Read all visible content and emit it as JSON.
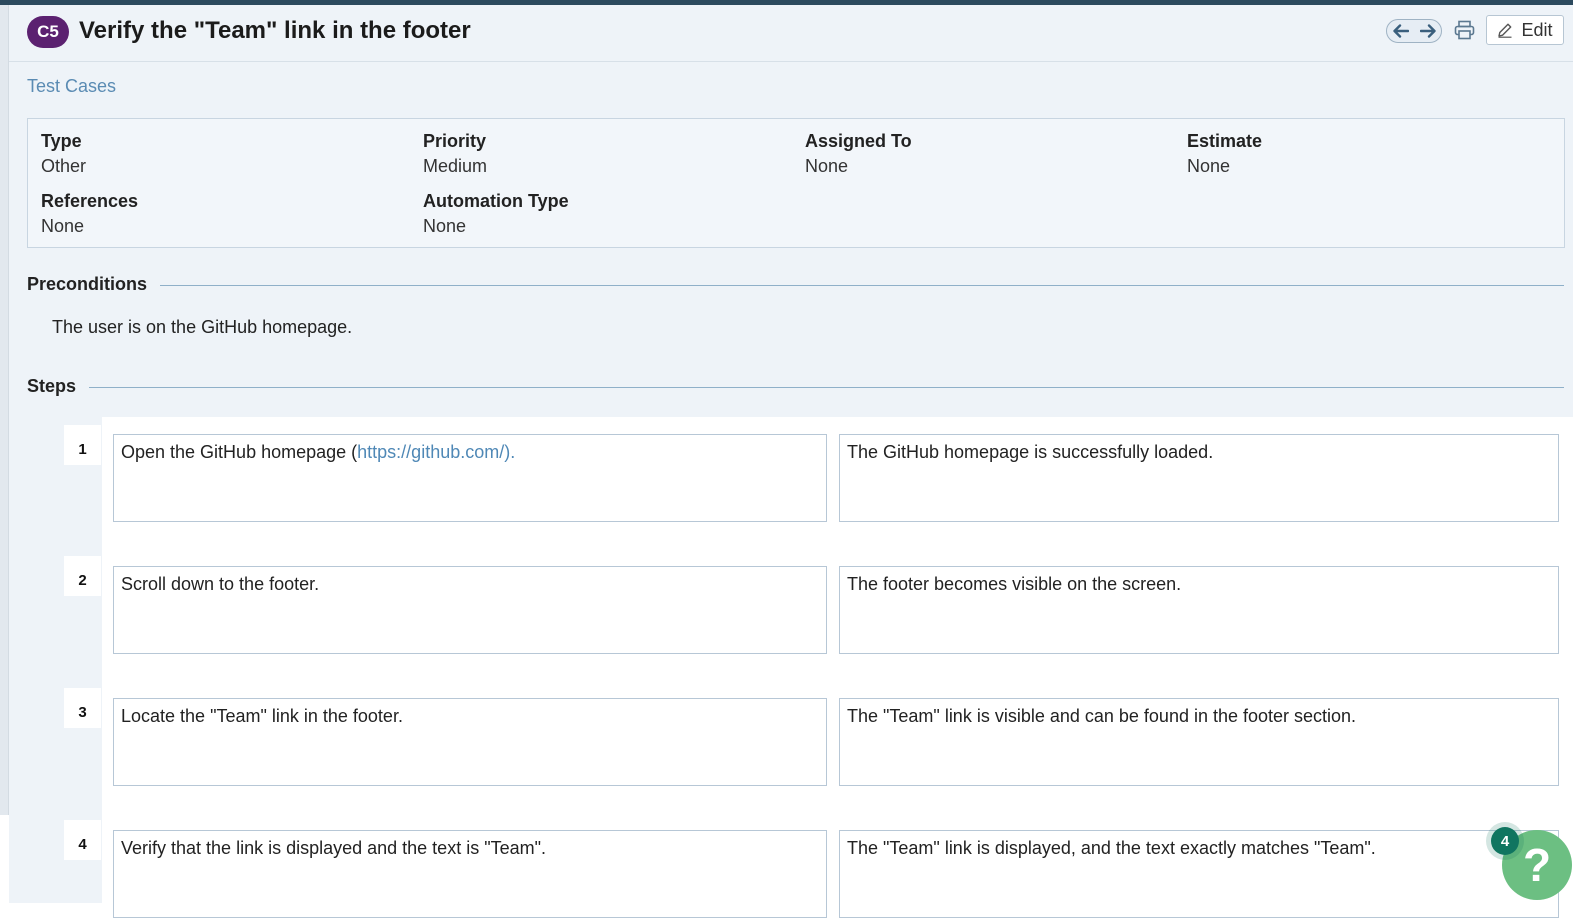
{
  "header": {
    "case_id": "C5",
    "title": "Verify the \"Team\" link in the footer",
    "edit_label": "Edit"
  },
  "breadcrumb": "Test Cases",
  "properties": {
    "type": {
      "label": "Type",
      "value": "Other"
    },
    "priority": {
      "label": "Priority",
      "value": "Medium"
    },
    "assigned_to": {
      "label": "Assigned To",
      "value": "None"
    },
    "estimate": {
      "label": "Estimate",
      "value": "None"
    },
    "references": {
      "label": "References",
      "value": "None"
    },
    "automation_type": {
      "label": "Automation Type",
      "value": "None"
    }
  },
  "preconditions": {
    "heading": "Preconditions",
    "text": "The user is on the GitHub homepage."
  },
  "steps": {
    "heading": "Steps",
    "items": [
      {
        "num": "1",
        "action_prefix": "Open the GitHub homepage (",
        "action_link": "https://github.com/).",
        "expected": "The GitHub homepage is successfully loaded."
      },
      {
        "num": "2",
        "action": "Scroll down to the footer.",
        "expected": "The footer becomes visible on the screen."
      },
      {
        "num": "3",
        "action": "Locate the \"Team\" link in the footer.",
        "expected": "The \"Team\" link is visible and can be found in the footer section."
      },
      {
        "num": "4",
        "action": "Verify that the link is displayed and the text is \"Team\".",
        "expected": "The \"Team\" link is displayed, and the text exactly matches \"Team\"."
      }
    ]
  },
  "help": {
    "badge_count": "4",
    "button_glyph": "?"
  },
  "icons": {
    "prev": "arrow-left-icon",
    "next": "arrow-right-icon",
    "print": "printer-icon",
    "edit": "pencil-icon"
  },
  "colors": {
    "case_badge": "#5b2170",
    "link": "#5a8bb3",
    "help_button": "#6cbf82",
    "help_badge": "#107560"
  }
}
